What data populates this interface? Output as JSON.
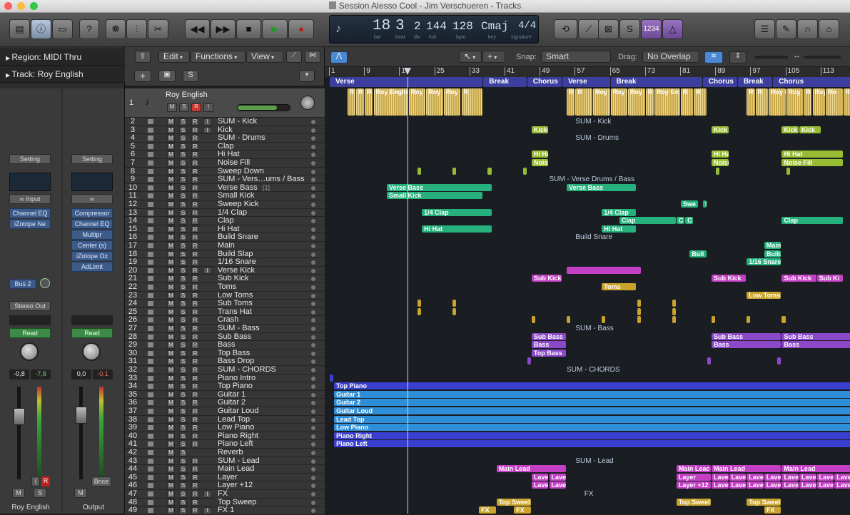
{
  "window": {
    "title": "Session Alesso Cool - Jim Verschueren - Tracks"
  },
  "lcd": {
    "bar": "18",
    "beat": "3",
    "div": "2",
    "tick": "144",
    "bpm": "128",
    "key": "Cmaj",
    "signature": "4/4",
    "labels": {
      "bar": "bar",
      "beat": "beat",
      "div": "div",
      "tick": "tick",
      "bpm": "bpm",
      "key": "key",
      "signature": "signature"
    }
  },
  "toolbar": {
    "count_in": "1234"
  },
  "inspector": {
    "region": "Region: MIDI Thru",
    "track": "Track: Roy English",
    "strip1": {
      "setting": "Setting",
      "input": "Input",
      "plugins": [
        "Channel EQ",
        "iZotope Ne"
      ],
      "send": "Bus 2",
      "output": "Stereo Out",
      "read": "Read",
      "pan_values": [
        "-0,8",
        "-7,8"
      ],
      "name": "Roy English",
      "mute": "M",
      "solo": "S",
      "i": "I",
      "r": "R"
    },
    "strip2": {
      "setting": "Setting",
      "plugins": [
        "Compressor",
        "Channel EQ",
        "Multipr",
        "Center (s)",
        "iZotope Oz",
        "AdLimit"
      ],
      "read": "Read",
      "pan_values": [
        "0,0",
        "-0,1"
      ],
      "name": "Output",
      "mute": "M",
      "bounce": "Bnce"
    }
  },
  "local": {
    "edit": "Edit",
    "functions": "Functions",
    "view": "View",
    "snap_label": "Snap:",
    "snap": "Smart",
    "drag_label": "Drag:",
    "drag": "No Overlap"
  },
  "track1": {
    "name": "Roy English",
    "buttons": [
      "M",
      "S",
      "R",
      "I"
    ]
  },
  "ruler": {
    "ticks": [
      {
        "label": "1",
        "bar": 1
      },
      {
        "label": "9",
        "bar": 9
      },
      {
        "label": "17",
        "bar": 17
      },
      {
        "label": "25",
        "bar": 25
      },
      {
        "label": "33",
        "bar": 33
      },
      {
        "label": "41",
        "bar": 41
      },
      {
        "label": "49",
        "bar": 49
      },
      {
        "label": "57",
        "bar": 57
      },
      {
        "label": "65",
        "bar": 65
      },
      {
        "label": "73",
        "bar": 73
      },
      {
        "label": "81",
        "bar": 81
      },
      {
        "label": "89",
        "bar": 89
      },
      {
        "label": "97",
        "bar": 97
      },
      {
        "label": "105",
        "bar": 105
      },
      {
        "label": "113",
        "bar": 113
      }
    ],
    "sections": [
      {
        "label": "Verse",
        "start": 1,
        "end": 36
      },
      {
        "label": "Break",
        "start": 36,
        "end": 46
      },
      {
        "label": "Chorus",
        "start": 46,
        "end": 54
      },
      {
        "label": "Verse",
        "start": 54,
        "end": 65
      },
      {
        "label": "Break",
        "start": 65,
        "end": 86
      },
      {
        "label": "Chorus",
        "start": 86,
        "end": 94
      },
      {
        "label": "Break",
        "start": 94,
        "end": 102
      },
      {
        "label": "Chorus",
        "start": 102,
        "end": 121
      }
    ]
  },
  "tracks": [
    {
      "n": "2",
      "name": "SUM - Kick",
      "btns": [
        "M",
        "S",
        "R",
        "I"
      ]
    },
    {
      "n": "3",
      "name": "Kick",
      "btns": [
        "M",
        "S",
        "R",
        "I"
      ]
    },
    {
      "n": "4",
      "name": "SUM - Drums",
      "btns": [
        "M",
        "S",
        "R"
      ]
    },
    {
      "n": "5",
      "name": "Clap",
      "btns": [
        "M",
        "S",
        "R"
      ]
    },
    {
      "n": "6",
      "name": "Hi Hat",
      "btns": [
        "M",
        "S",
        "R"
      ]
    },
    {
      "n": "7",
      "name": "Noise Fill",
      "btns": [
        "M",
        "S",
        "R"
      ]
    },
    {
      "n": "8",
      "name": "Sweep Down",
      "btns": [
        "M",
        "S",
        "R"
      ]
    },
    {
      "n": "9",
      "name": "SUM - Vers…ums / Bass",
      "btns": [
        "M",
        "S",
        "R"
      ]
    },
    {
      "n": "10",
      "name": "Verse Bass",
      "btns": [
        "M",
        "S",
        "R"
      ],
      "extra": "[1]"
    },
    {
      "n": "11",
      "name": "Small Kick",
      "btns": [
        "M",
        "S",
        "R"
      ]
    },
    {
      "n": "12",
      "name": "Sweep Kick",
      "btns": [
        "M",
        "S",
        "R"
      ]
    },
    {
      "n": "13",
      "name": "1/4 Clap",
      "btns": [
        "M",
        "S",
        "R"
      ]
    },
    {
      "n": "14",
      "name": "Clap",
      "btns": [
        "M",
        "S",
        "R"
      ]
    },
    {
      "n": "15",
      "name": "Hi Hat",
      "btns": [
        "M",
        "S",
        "R"
      ]
    },
    {
      "n": "16",
      "name": "Build Snare",
      "btns": [
        "M",
        "S",
        "R"
      ]
    },
    {
      "n": "17",
      "name": "Main",
      "btns": [
        "M",
        "S",
        "R"
      ]
    },
    {
      "n": "18",
      "name": "Build Slap",
      "btns": [
        "M",
        "S",
        "R"
      ]
    },
    {
      "n": "19",
      "name": "1/16 Snare",
      "btns": [
        "M",
        "S",
        "R"
      ]
    },
    {
      "n": "20",
      "name": "Verse Kick",
      "btns": [
        "M",
        "S",
        "R",
        "I"
      ]
    },
    {
      "n": "21",
      "name": "Sub Kick",
      "btns": [
        "M",
        "S",
        "R"
      ]
    },
    {
      "n": "22",
      "name": "Toms",
      "btns": [
        "M",
        "S",
        "R"
      ]
    },
    {
      "n": "23",
      "name": "Low Toms",
      "btns": [
        "M",
        "S",
        "R"
      ]
    },
    {
      "n": "24",
      "name": "Sub Toms",
      "btns": [
        "M",
        "S",
        "R"
      ]
    },
    {
      "n": "25",
      "name": "Trans Hat",
      "btns": [
        "M",
        "S",
        "R"
      ]
    },
    {
      "n": "26",
      "name": "Crash",
      "btns": [
        "M",
        "S",
        "R"
      ]
    },
    {
      "n": "27",
      "name": "SUM - Bass",
      "btns": [
        "M",
        "S",
        "R"
      ]
    },
    {
      "n": "28",
      "name": "Sub Bass",
      "btns": [
        "M",
        "S",
        "R"
      ]
    },
    {
      "n": "29",
      "name": "Bass",
      "btns": [
        "M",
        "S",
        "R"
      ]
    },
    {
      "n": "30",
      "name": "Top Bass",
      "btns": [
        "M",
        "S",
        "R"
      ]
    },
    {
      "n": "31",
      "name": "Bass Drop",
      "btns": [
        "M",
        "S",
        "R"
      ]
    },
    {
      "n": "32",
      "name": "SUM - CHORDS",
      "btns": [
        "M",
        "S",
        "R"
      ]
    },
    {
      "n": "33",
      "name": "Piano Intro",
      "btns": [
        "M",
        "S",
        "R"
      ]
    },
    {
      "n": "34",
      "name": "Top Piano",
      "btns": [
        "M",
        "S",
        "R"
      ]
    },
    {
      "n": "35",
      "name": "Guitar 1",
      "btns": [
        "M",
        "S",
        "R"
      ]
    },
    {
      "n": "36",
      "name": "Guitar 2",
      "btns": [
        "M",
        "S",
        "R"
      ]
    },
    {
      "n": "37",
      "name": "Guitar Loud",
      "btns": [
        "M",
        "S",
        "R"
      ]
    },
    {
      "n": "38",
      "name": "Lead Top",
      "btns": [
        "M",
        "S",
        "R"
      ]
    },
    {
      "n": "39",
      "name": "Low Piano",
      "btns": [
        "M",
        "S",
        "R"
      ]
    },
    {
      "n": "40",
      "name": "Piano Right",
      "btns": [
        "M",
        "S",
        "R"
      ]
    },
    {
      "n": "41",
      "name": "Piano Left",
      "btns": [
        "M",
        "S",
        "R"
      ]
    },
    {
      "n": "42",
      "name": "Reverb",
      "btns": [
        "M",
        "S"
      ]
    },
    {
      "n": "43",
      "name": "SUM - Lead",
      "btns": [
        "M",
        "S",
        "R"
      ]
    },
    {
      "n": "44",
      "name": "Main Lead",
      "btns": [
        "M",
        "S",
        "R"
      ]
    },
    {
      "n": "45",
      "name": "Layer",
      "btns": [
        "M",
        "S",
        "R"
      ]
    },
    {
      "n": "46",
      "name": "Layer +12",
      "btns": [
        "M",
        "S",
        "R"
      ]
    },
    {
      "n": "47",
      "name": "FX",
      "btns": [
        "M",
        "S",
        "R",
        "I"
      ]
    },
    {
      "n": "48",
      "name": "Top Sweep",
      "btns": [
        "M",
        "S",
        "R"
      ]
    },
    {
      "n": "49",
      "name": "FX 1",
      "btns": [
        "M",
        "S",
        "R",
        "I"
      ]
    }
  ],
  "sums": [
    {
      "label": "SUM - Kick",
      "row": 0,
      "bar": 57
    },
    {
      "label": "SUM - Drums",
      "row": 2,
      "bar": 57
    },
    {
      "label": "SUM - Verse Drums / Bass",
      "row": 7,
      "bar": 51
    },
    {
      "label": "Build Snare",
      "row": 14,
      "bar": 57
    },
    {
      "label": "SUM - Bass",
      "row": 25,
      "bar": 57
    },
    {
      "label": "SUM - CHORDS",
      "row": 30,
      "bar": 55
    },
    {
      "label": "SUM - Lead",
      "row": 41,
      "bar": 57
    },
    {
      "label": "FX",
      "row": 45,
      "bar": 59
    }
  ],
  "region_labels": {
    "kick": "Kick",
    "hihat": "Hi Hat",
    "noisefill": "Noise Fill",
    "versebass": "Verse Bass",
    "smallkick": "Small Kick",
    "swe": "Swe",
    "s": "S",
    "quarterclap": "1/4 Clap",
    "clap": "Clap",
    "c": "C",
    "main": "Main",
    "buil": "Buil",
    "build": "Build",
    "snare16": "1/16 Snare",
    "subkick": "Sub Kick",
    "subki": "Sub Ki",
    "toms": "Toms",
    "lowtoms": "Low Toms",
    "subbass": "Sub Bass",
    "bass": "Bass",
    "topbass": "Top Bass",
    "toppiano": "Top Piano",
    "guitar1": "Guitar 1",
    "guitar2": "Guitar 2",
    "guitarloud": "Guitar Loud",
    "leadtop": "Lead Top",
    "lowpiano": "Low Piano",
    "pianoright": "Piano Right",
    "pianoleft": "Piano Left",
    "mainlead": "Main Lead",
    "mainleac": "Main Leac",
    "layer": "Layer",
    "lave": "Lave",
    "layer12": "Layer +12",
    "lave12": "Lave",
    "topsweep": "Top Sweep",
    "topsweel": "Top Sweel",
    "fx": "FX",
    "roy": "Roy English",
    "r": "R",
    "royshort": "Roy",
    "royen": "Roy En",
    "roye": "Roy E",
    "ro": "Ro"
  },
  "colors": {
    "yellow": "#c8a84a",
    "green": "#97bb33",
    "teal": "#25b07c",
    "orange": "#c9a32c",
    "purple": "#8b48c9",
    "blue": "#3b3fcf",
    "cyan": "#2f8ed8",
    "pink": "#c33fc4",
    "section": "#3c3f9d",
    "playhead": "#cfd5de"
  }
}
